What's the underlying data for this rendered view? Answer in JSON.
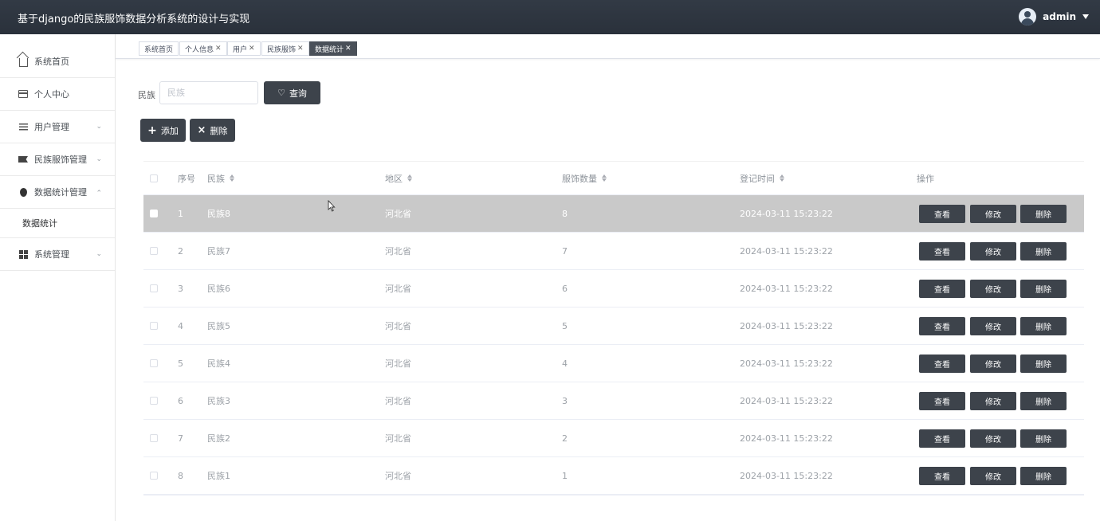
{
  "header": {
    "title": "基于django的民族服饰数据分析系统的设计与实现",
    "username": "admin"
  },
  "sidebar": {
    "items": [
      {
        "label": "系统首页",
        "icon": "home-icon"
      },
      {
        "label": "个人中心",
        "icon": "card-icon"
      },
      {
        "label": "用户管理",
        "icon": "list-icon"
      },
      {
        "label": "民族服饰管理",
        "icon": "flag-icon"
      },
      {
        "label": "数据统计管理",
        "icon": "balloon-icon"
      },
      {
        "label": "系统管理",
        "icon": "grid-icon"
      }
    ],
    "submenu": {
      "label": "数据统计"
    }
  },
  "tags": [
    {
      "label": "系统首页"
    },
    {
      "label": "个人信息"
    },
    {
      "label": "用户"
    },
    {
      "label": "民族服饰"
    },
    {
      "label": "数据统计"
    }
  ],
  "search": {
    "label": "民族",
    "placeholder": "民族",
    "button": "查询"
  },
  "actions": {
    "add": "添加",
    "delete": "删除"
  },
  "table": {
    "headers": {
      "index": "序号",
      "name": "民族",
      "region": "地区",
      "qty": "服饰数量",
      "time": "登记时间",
      "ops": "操作"
    },
    "rows": [
      {
        "index": "1",
        "name": "民族8",
        "region": "河北省",
        "qty": "8",
        "time": "2024-03-11 15:23:22"
      },
      {
        "index": "2",
        "name": "民族7",
        "region": "河北省",
        "qty": "7",
        "time": "2024-03-11 15:23:22"
      },
      {
        "index": "3",
        "name": "民族6",
        "region": "河北省",
        "qty": "6",
        "time": "2024-03-11 15:23:22"
      },
      {
        "index": "4",
        "name": "民族5",
        "region": "河北省",
        "qty": "5",
        "time": "2024-03-11 15:23:22"
      },
      {
        "index": "5",
        "name": "民族4",
        "region": "河北省",
        "qty": "4",
        "time": "2024-03-11 15:23:22"
      },
      {
        "index": "6",
        "name": "民族3",
        "region": "河北省",
        "qty": "3",
        "time": "2024-03-11 15:23:22"
      },
      {
        "index": "7",
        "name": "民族2",
        "region": "河北省",
        "qty": "2",
        "time": "2024-03-11 15:23:22"
      },
      {
        "index": "8",
        "name": "民族1",
        "region": "河北省",
        "qty": "1",
        "time": "2024-03-11 15:23:22"
      }
    ],
    "op_labels": {
      "view": "查看",
      "edit": "修改",
      "delete": "删除"
    }
  },
  "colors": {
    "header_bg": "#2f3640",
    "button_bg": "#3d434b",
    "highlight_row": "#c9c9c9"
  }
}
